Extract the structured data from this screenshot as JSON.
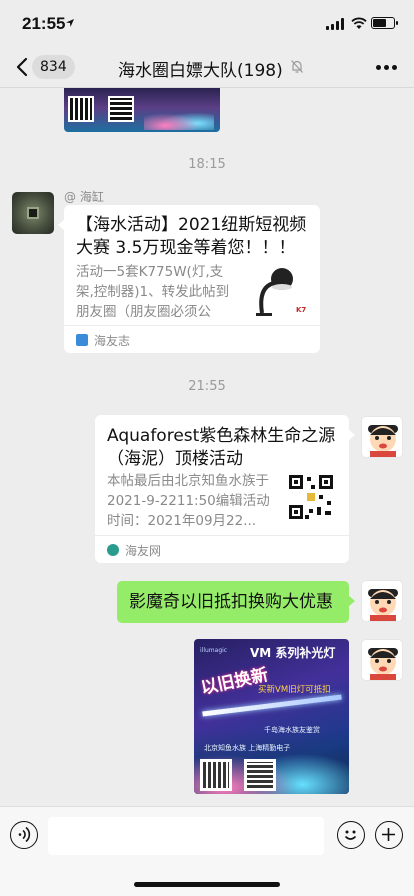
{
  "status_bar": {
    "time": "21:55"
  },
  "nav": {
    "unread_count": "834",
    "title": "海水圈白嫖大队(198)"
  },
  "chat": {
    "timestamps": [
      "18:15",
      "21:55"
    ],
    "messages": [
      {
        "sender": "@ 海缸",
        "title": "【海水活动】2021纽斯短视频大赛 3.5万现金等着您！！！",
        "desc": "活动一5套K775W(灯,支架,控制器)1、转发此帖到朋友圈（朋友圈必须公开...",
        "source": "海友志",
        "thumb_label": "K7"
      },
      {
        "title": "Aquaforest紫色森林生命之源（海泥）顶楼活动",
        "desc": "本帖最后由北京知鱼水族于2021-9-2211:50编辑活动时间：2021年09月22...",
        "source": "海友网"
      },
      {
        "text": "影魔奇以旧抵扣换购大优惠"
      },
      {
        "poster": {
          "brand": "illumagic",
          "headline": "VM 系列补光灯",
          "big_text": "以旧换新",
          "sub_text": "买新VM旧灯可抵扣",
          "line1": "千岛海水族友鉴赏",
          "line2": "北京知鱼水族 上海精勤电子"
        }
      }
    ]
  },
  "icons": {
    "back": "chevron-left-icon",
    "mute": "bell-off-icon",
    "more": "more-dots-icon",
    "voice": "voice-icon",
    "emoji": "emoji-icon",
    "plus": "plus-icon"
  }
}
